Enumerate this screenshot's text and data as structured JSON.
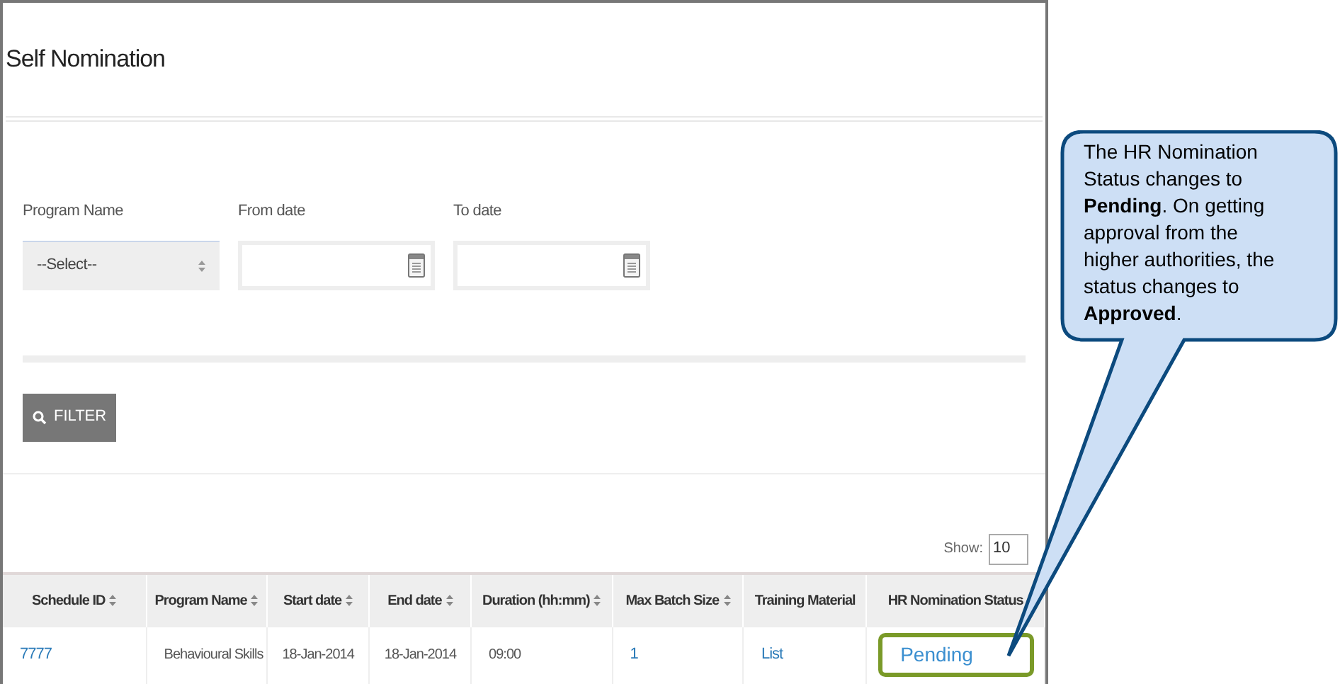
{
  "page": {
    "title": "Self Nomination"
  },
  "filters": [
    {
      "label": "Program Name",
      "kind": "select",
      "value": "--Select--"
    },
    {
      "label": "From date",
      "kind": "date"
    },
    {
      "label": "To date",
      "kind": "date"
    }
  ],
  "filter_button": {
    "label": "FILTER"
  },
  "show": {
    "label": "Show:",
    "value": "10"
  },
  "table": {
    "columns": [
      {
        "label": "Schedule ID",
        "sortable": true
      },
      {
        "label": "Program Name",
        "sortable": true
      },
      {
        "label": "Start date",
        "sortable": true
      },
      {
        "label": "End date",
        "sortable": true
      },
      {
        "label": "Duration (hh:mm)",
        "sortable": true
      },
      {
        "label": "Max Batch Size",
        "sortable": true
      },
      {
        "label": "Training Material",
        "sortable": false
      },
      {
        "label": "HR Nomination Status",
        "sortable": false
      }
    ],
    "rows": [
      [
        {
          "text": "7777",
          "kind": "link"
        },
        {
          "text": "Behavioural Skills",
          "kind": "text"
        },
        {
          "text": "18-Jan-2014",
          "kind": "text"
        },
        {
          "text": "18-Jan-2014",
          "kind": "text"
        },
        {
          "text": "09:00",
          "kind": "text"
        },
        {
          "text": "1",
          "kind": "link"
        },
        {
          "text": "List",
          "kind": "link"
        },
        {
          "text": "Pending",
          "kind": "status"
        }
      ]
    ]
  },
  "callout": {
    "text": "The HR Nomination Status changes to **Pending**. On getting approval from the higher authorities, the status changes to **Approved**."
  }
}
